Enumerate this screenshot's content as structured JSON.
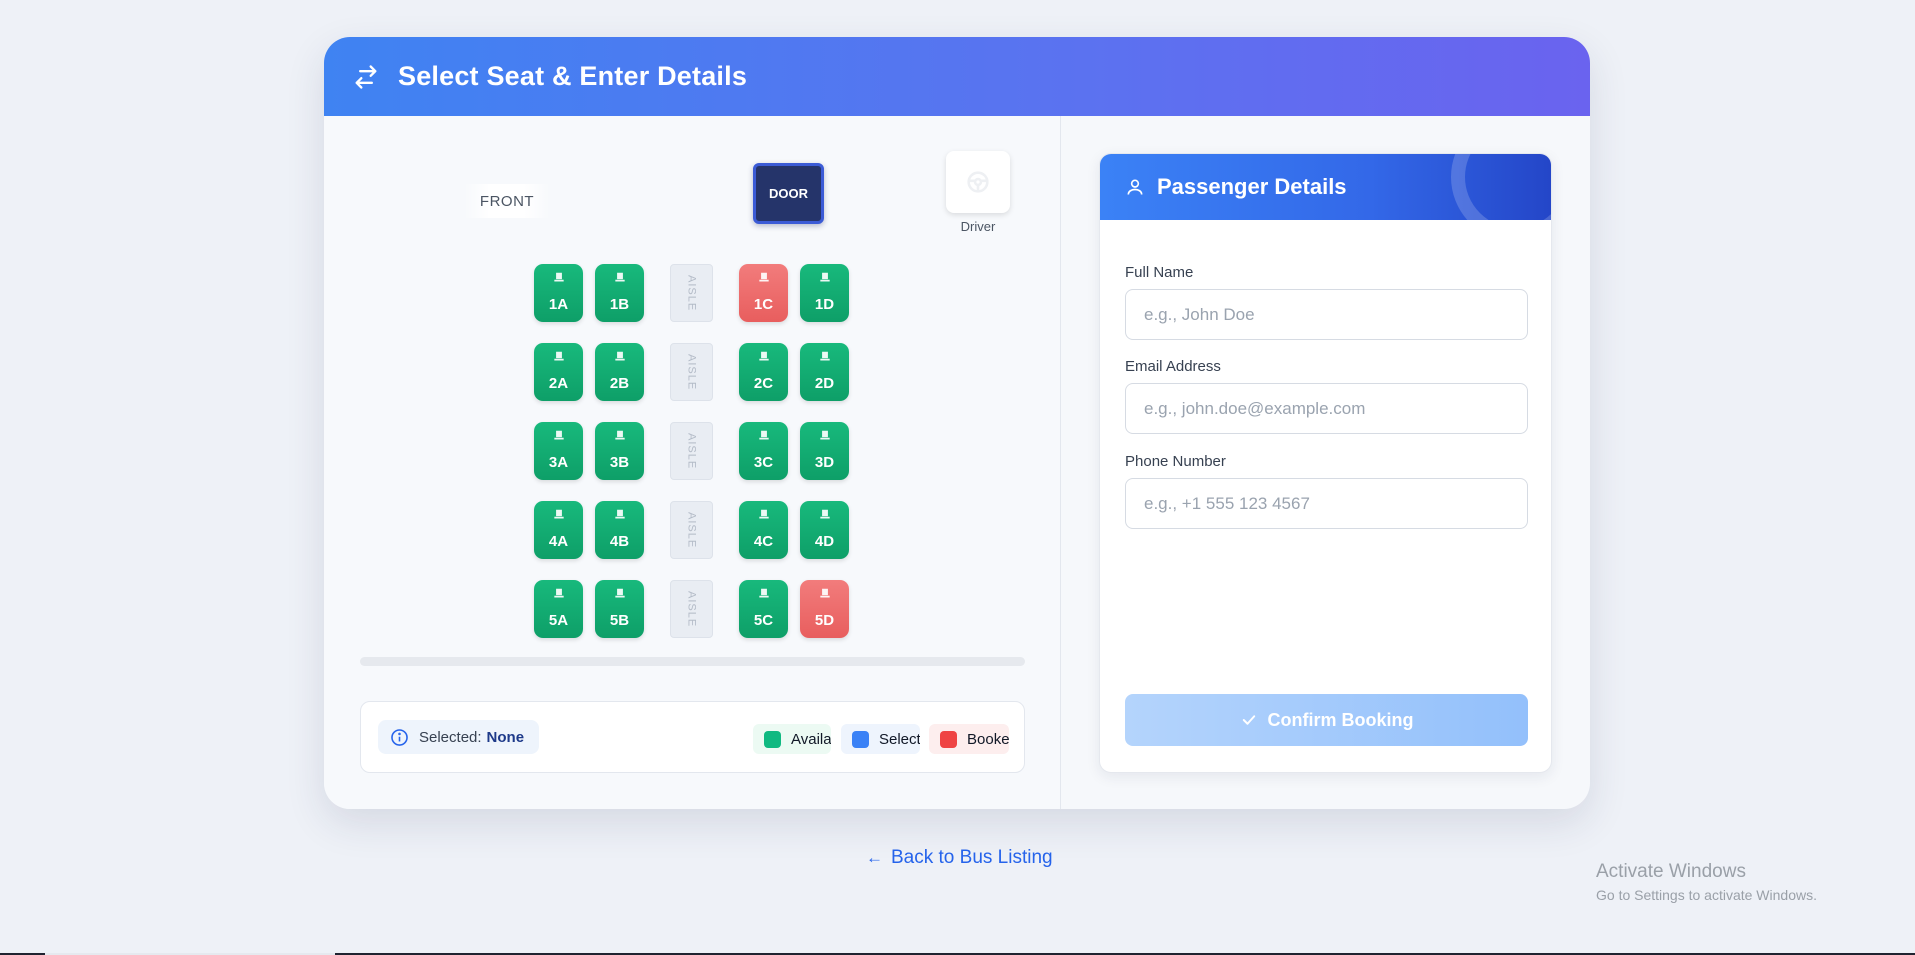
{
  "header": {
    "title": "Select Seat & Enter Details"
  },
  "layout_labels": {
    "front": "FRONT",
    "door": "DOOR",
    "driver": "Driver",
    "aisle": "AISLE"
  },
  "seats": {
    "rows": [
      {
        "left": [
          {
            "id": "1A",
            "status": "available"
          },
          {
            "id": "1B",
            "status": "available"
          }
        ],
        "right": [
          {
            "id": "1C",
            "status": "booked"
          },
          {
            "id": "1D",
            "status": "available"
          }
        ]
      },
      {
        "left": [
          {
            "id": "2A",
            "status": "available"
          },
          {
            "id": "2B",
            "status": "available"
          }
        ],
        "right": [
          {
            "id": "2C",
            "status": "available"
          },
          {
            "id": "2D",
            "status": "available"
          }
        ]
      },
      {
        "left": [
          {
            "id": "3A",
            "status": "available"
          },
          {
            "id": "3B",
            "status": "available"
          }
        ],
        "right": [
          {
            "id": "3C",
            "status": "available"
          },
          {
            "id": "3D",
            "status": "available"
          }
        ]
      },
      {
        "left": [
          {
            "id": "4A",
            "status": "available"
          },
          {
            "id": "4B",
            "status": "available"
          }
        ],
        "right": [
          {
            "id": "4C",
            "status": "available"
          },
          {
            "id": "4D",
            "status": "available"
          }
        ]
      },
      {
        "left": [
          {
            "id": "5A",
            "status": "available"
          },
          {
            "id": "5B",
            "status": "available"
          }
        ],
        "right": [
          {
            "id": "5C",
            "status": "available"
          },
          {
            "id": "5D",
            "status": "booked"
          }
        ]
      }
    ]
  },
  "selection": {
    "label": "Selected:",
    "value": "None"
  },
  "legend": [
    {
      "label": "Available",
      "color": "#10b981"
    },
    {
      "label": "Selected",
      "color": "#3b82f6"
    },
    {
      "label": "Booked",
      "color": "#ef4444"
    }
  ],
  "passenger": {
    "title": "Passenger Details",
    "fields": [
      {
        "label": "Full Name",
        "placeholder": "e.g., John Doe",
        "value": ""
      },
      {
        "label": "Email Address",
        "placeholder": "e.g., john.doe@example.com",
        "value": ""
      },
      {
        "label": "Phone Number",
        "placeholder": "e.g., +1 555 123 4567",
        "value": ""
      }
    ],
    "confirm_label": "Confirm Booking"
  },
  "back_link": "Back to Bus Listing",
  "watermark": {
    "line1": "Activate Windows",
    "line2": "Go to Settings to activate Windows."
  },
  "colors": {
    "accent": "#3b82f6",
    "available": "#10b981",
    "booked": "#ef4444",
    "door": "#25346a"
  }
}
